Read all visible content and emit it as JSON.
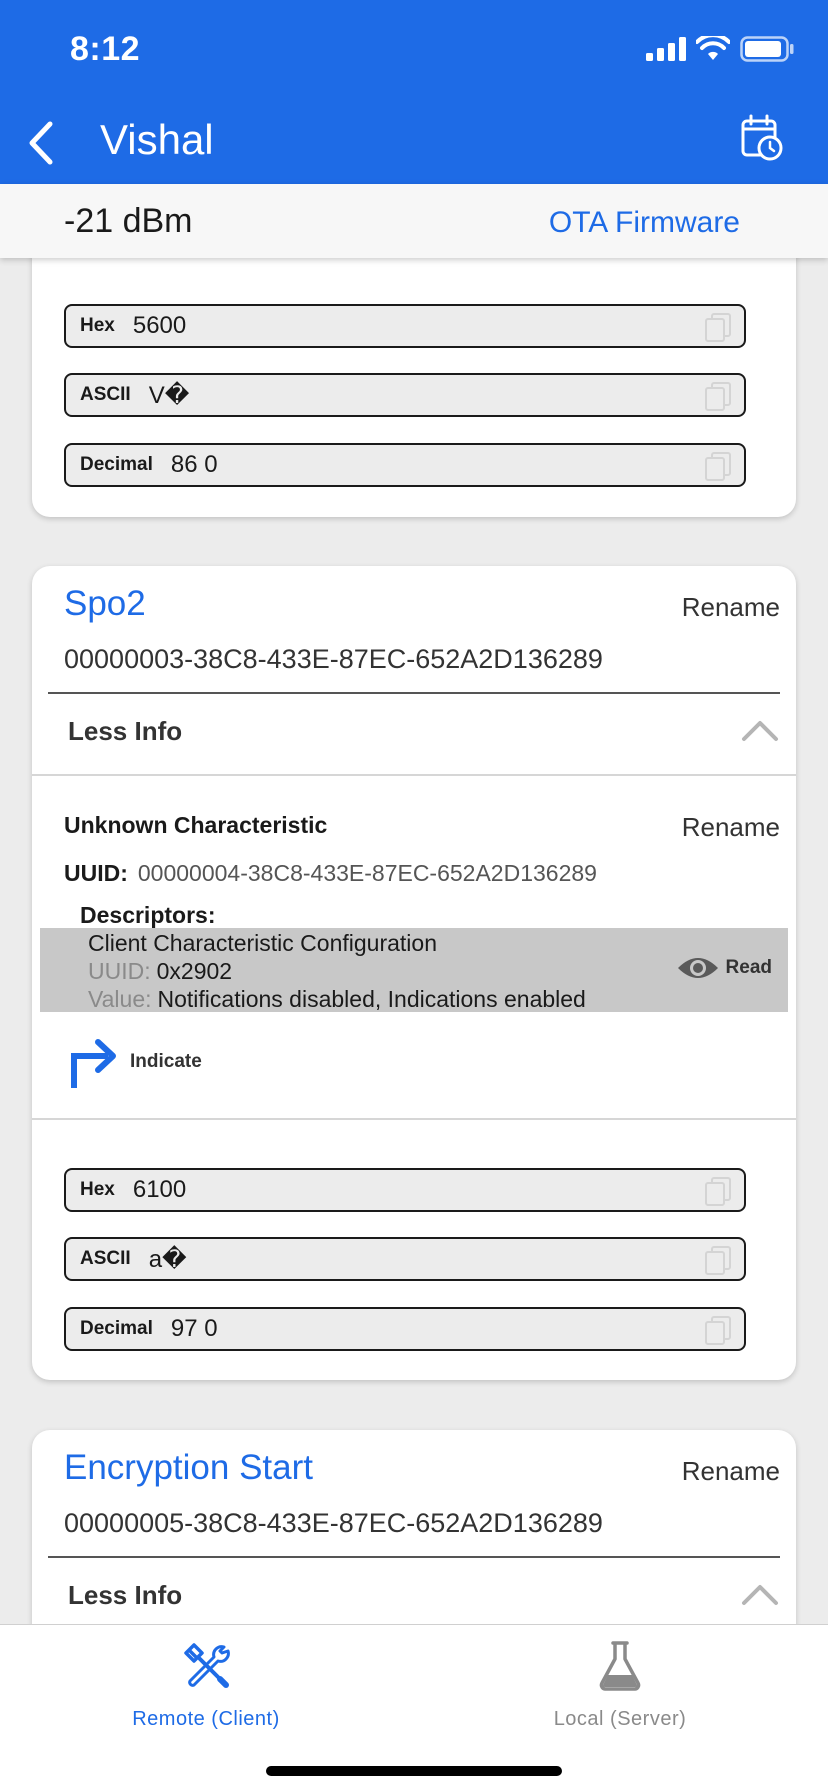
{
  "status": {
    "time": "8:12"
  },
  "nav": {
    "title": "Vishal",
    "back_icon": "chevron-left-icon",
    "schedule_icon": "calendar-clock-icon"
  },
  "connection": {
    "rssi": "-21 dBm",
    "ota_label": "OTA Firmware"
  },
  "top_card": {
    "fields": [
      {
        "label": "Hex",
        "value": "5600"
      },
      {
        "label": "ASCII",
        "value": "V�"
      },
      {
        "label": "Decimal",
        "value": "86 0"
      }
    ]
  },
  "spo2": {
    "title": "Spo2",
    "rename": "Rename",
    "uuid": "00000003-38C8-433E-87EC-652A2D136289",
    "less_info": "Less Info",
    "characteristic": {
      "name": "Unknown Characteristic",
      "rename": "Rename",
      "uuid_label": "UUID:",
      "uuid": "00000004-38C8-433E-87EC-652A2D136289",
      "descriptors_label": "Descriptors:",
      "descriptor": {
        "name": "Client Characteristic Configuration",
        "uuid_label": "UUID:",
        "uuid": "0x2902",
        "value_label": "Value:",
        "value": "Notifications disabled, Indications enabled",
        "read_label": "Read"
      },
      "indicate_label": "Indicate"
    },
    "fields": [
      {
        "label": "Hex",
        "value": "6100"
      },
      {
        "label": "ASCII",
        "value": "a�"
      },
      {
        "label": "Decimal",
        "value": "97 0"
      }
    ]
  },
  "encryption": {
    "title": "Encryption Start",
    "rename": "Rename",
    "uuid": "00000005-38C8-433E-87EC-652A2D136289",
    "less_info": "Less Info"
  },
  "tabs": [
    {
      "label": "Remote (Client)",
      "icon": "tools-icon",
      "active": true
    },
    {
      "label": "Local (Server)",
      "icon": "flask-icon",
      "active": false
    }
  ],
  "colors": {
    "accent": "#1e6be6",
    "descriptor_bg": "#c8c8c8"
  }
}
